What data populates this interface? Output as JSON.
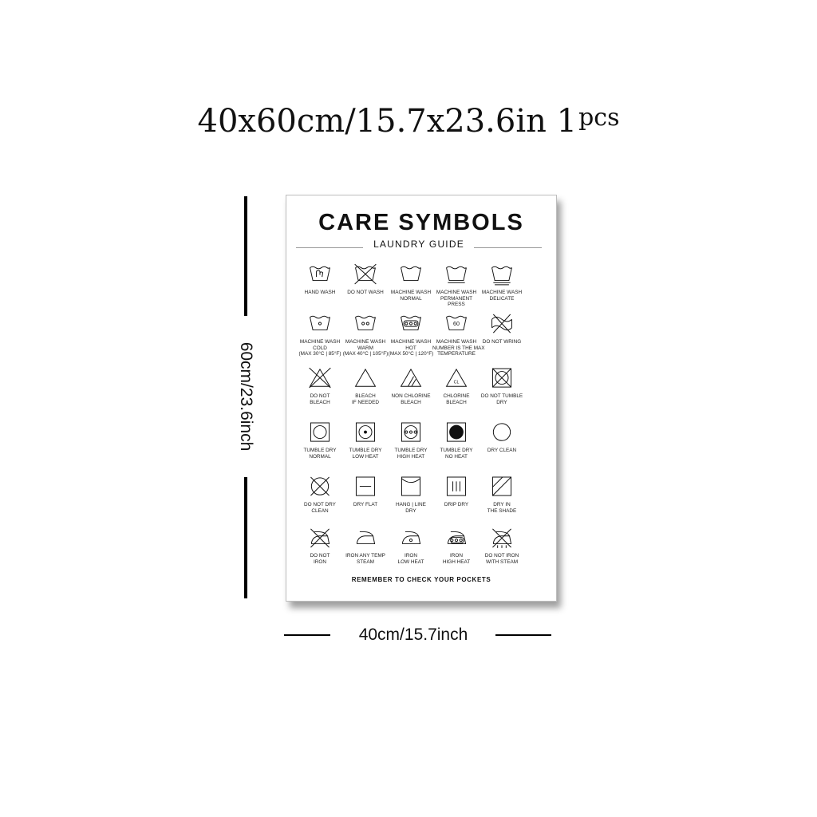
{
  "size_heading": {
    "main": "40x60cm/15.7x23.6in 1",
    "sup": "pcs"
  },
  "height_dimension": "60cm/23.6inch",
  "width_dimension": "40cm/15.7inch",
  "poster": {
    "title": "CARE SYMBOLS",
    "subtitle": "LAUNDRY GUIDE",
    "footer": "REMEMBER TO CHECK YOUR POCKETS",
    "symbols": [
      {
        "icon": "hand-wash-icon",
        "label": [
          "HAND WASH"
        ]
      },
      {
        "icon": "do-not-wash-icon",
        "label": [
          "DO NOT WASH"
        ]
      },
      {
        "icon": "machine-wash-normal-icon",
        "label": [
          "MACHINE WASH",
          "NORMAL"
        ]
      },
      {
        "icon": "machine-wash-permanent-press-icon",
        "label": [
          "MACHINE WASH",
          "PERMANENT",
          "PRESS"
        ]
      },
      {
        "icon": "machine-wash-delicate-icon",
        "label": [
          "MACHINE WASH",
          "DELICATE"
        ]
      },
      {
        "icon": "machine-wash-cold-icon",
        "label": [
          "MACHINE WASH",
          "COLD",
          "(MAX 30°C | 85°F)"
        ]
      },
      {
        "icon": "machine-wash-warm-icon",
        "label": [
          "MACHINE WASH",
          "WARM",
          "(MAX 40°C | 105°F)"
        ]
      },
      {
        "icon": "machine-wash-hot-icon",
        "label": [
          "MACHINE WASH",
          "HOT",
          "(MAX 50°C | 120°F)"
        ]
      },
      {
        "icon": "machine-wash-60-icon",
        "label": [
          "MACHINE WASH",
          "NUMBER IS THE MAX",
          "TEMPERATURE"
        ],
        "number": "60"
      },
      {
        "icon": "do-not-wring-icon",
        "label": [
          "DO NOT WRING"
        ]
      },
      {
        "icon": "do-not-bleach-icon",
        "label": [
          "DO NOT",
          "BLEACH"
        ]
      },
      {
        "icon": "bleach-if-needed-icon",
        "label": [
          "BLEACH",
          "IF NEEDED"
        ]
      },
      {
        "icon": "non-chlorine-bleach-icon",
        "label": [
          "NON CHLORINE",
          "BLEACH"
        ]
      },
      {
        "icon": "chlorine-bleach-icon",
        "label": [
          "CHLORINE",
          "BLEACH"
        ],
        "mark": "CL"
      },
      {
        "icon": "do-not-tumble-dry-icon",
        "label": [
          "DO NOT TUMBLE",
          "DRY"
        ]
      },
      {
        "icon": "tumble-dry-normal-icon",
        "label": [
          "TUMBLE DRY",
          "NORMAL"
        ]
      },
      {
        "icon": "tumble-dry-low-heat-icon",
        "label": [
          "TUMBLE DRY",
          "LOW HEAT"
        ]
      },
      {
        "icon": "tumble-dry-high-heat-icon",
        "label": [
          "TUMBLE DRY",
          "HIGH HEAT"
        ]
      },
      {
        "icon": "tumble-dry-no-heat-icon",
        "label": [
          "TUMBLE DRY",
          "NO HEAT"
        ]
      },
      {
        "icon": "dry-clean-icon",
        "label": [
          "DRY CLEAN"
        ]
      },
      {
        "icon": "do-not-dry-clean-icon",
        "label": [
          "DO NOT DRY",
          "CLEAN"
        ]
      },
      {
        "icon": "dry-flat-icon",
        "label": [
          "DRY FLAT"
        ]
      },
      {
        "icon": "hang-line-dry-icon",
        "label": [
          "HANG | LINE",
          "DRY"
        ]
      },
      {
        "icon": "drip-dry-icon",
        "label": [
          "DRIP DRY"
        ]
      },
      {
        "icon": "dry-in-shade-icon",
        "label": [
          "DRY IN",
          "THE SHADE"
        ]
      },
      {
        "icon": "do-not-iron-icon",
        "label": [
          "DO NOT",
          "IRON"
        ]
      },
      {
        "icon": "iron-any-temp-icon",
        "label": [
          "IRON ANY TEMP",
          "STEAM"
        ]
      },
      {
        "icon": "iron-low-heat-icon",
        "label": [
          "IRON",
          "LOW HEAT"
        ]
      },
      {
        "icon": "iron-high-heat-icon",
        "label": [
          "IRON",
          "HIGH HEAT"
        ]
      },
      {
        "icon": "do-not-iron-with-steam-icon",
        "label": [
          "DO NOT IRON",
          "WITH STEAM"
        ]
      }
    ]
  }
}
